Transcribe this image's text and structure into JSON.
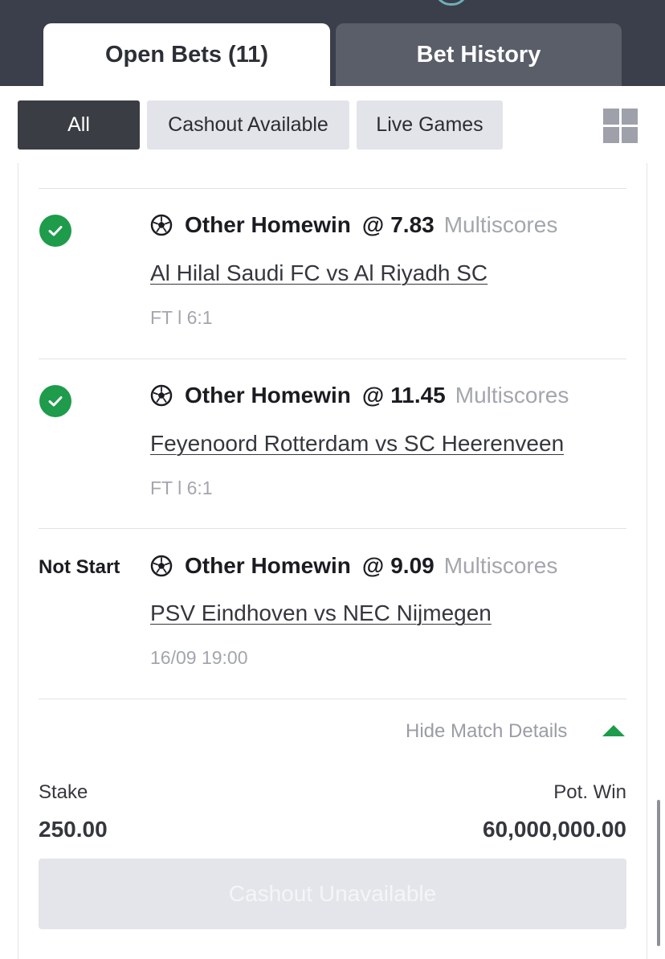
{
  "tabs": {
    "open_bets": "Open Bets (11)",
    "bet_history": "Bet History"
  },
  "filters": {
    "all": "All",
    "cashout_available": "Cashout Available",
    "live_games": "Live Games"
  },
  "bets": [
    {
      "status": "won",
      "status_icon": "check-icon",
      "market": "Other Homewin",
      "at": "@",
      "odds": "7.83",
      "type": "Multiscores",
      "match": "Al Hilal Saudi FC vs Al Riyadh SC",
      "meta": "FT  l 6:1"
    },
    {
      "status": "won",
      "status_icon": "check-icon",
      "market": "Other Homewin",
      "at": "@",
      "odds": "11.45",
      "type": "Multiscores",
      "match": "Feyenoord Rotterdam vs SC Heerenveen",
      "meta": "FT  l 6:1"
    },
    {
      "status": "Not Start",
      "market": "Other Homewin",
      "at": "@",
      "odds": "9.09",
      "type": "Multiscores",
      "match": "PSV Eindhoven vs NEC Nijmegen",
      "meta": "16/09 19:00"
    }
  ],
  "details": {
    "hide_label": "Hide Match Details"
  },
  "summary": {
    "stake_label": "Stake",
    "stake_value": "250.00",
    "pot_win_label": "Pot. Win",
    "pot_win_value": "60,000,000.00"
  },
  "cashout": {
    "label": "Cashout Unavailable"
  },
  "colors": {
    "header_bg": "#3b3f4b",
    "success_green": "#1e9b4b",
    "chip_active": "#3b3d44",
    "chip_inactive": "#e3e4ea"
  }
}
